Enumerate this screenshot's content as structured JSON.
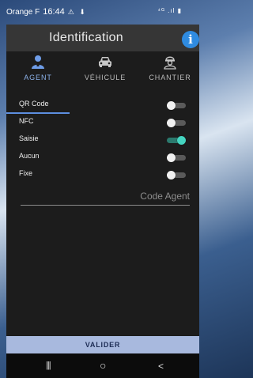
{
  "status": {
    "carrier": "Orange F",
    "time": "16:44",
    "icons": "⚠ ⬇",
    "right_icons": "⁴ᴳ .ıl ▮"
  },
  "header": {
    "title": "Identification",
    "info_label": "i"
  },
  "tabs": [
    {
      "label": "AGENT",
      "icon": "person-icon",
      "active": true
    },
    {
      "label": "VÉHICULE",
      "icon": "car-icon",
      "active": false
    },
    {
      "label": "CHANTIER",
      "icon": "worker-icon",
      "active": false
    }
  ],
  "options": [
    {
      "label": "QR Code",
      "enabled": false
    },
    {
      "label": "NFC",
      "enabled": false
    },
    {
      "label": "Saisie",
      "enabled": true
    },
    {
      "label": "Aucun",
      "enabled": false
    },
    {
      "label": "Fixe",
      "enabled": false
    }
  ],
  "code_agent": {
    "placeholder": "Code Agent",
    "value": ""
  },
  "actions": {
    "validate_label": "VALIDER"
  },
  "navbar": {
    "recents": "|||",
    "home": "○",
    "back": "<"
  },
  "colors": {
    "accent": "#5d8fe0",
    "toggle_on": "#45d4c0",
    "button_bg": "#a8b9de",
    "info_blue": "#2f8be0"
  }
}
